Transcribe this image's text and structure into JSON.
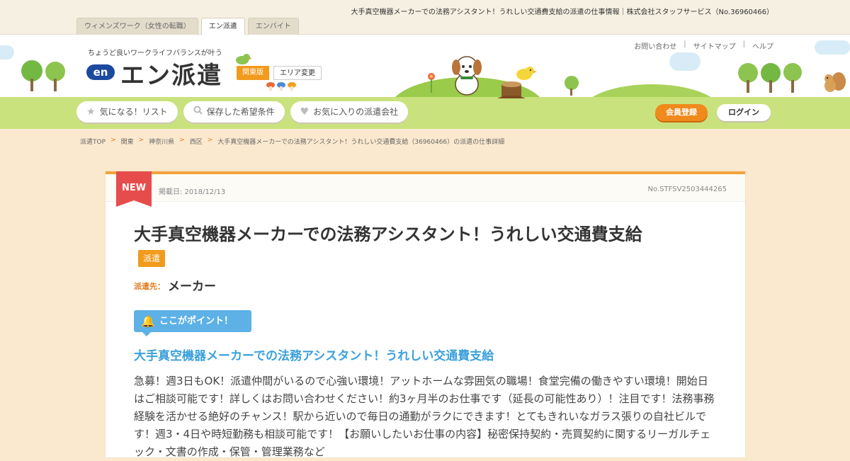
{
  "window": {
    "title": "大手真空機器メーカーでの法務アシスタント！うれしい交通費支給の派遣の仕事情報｜株式会社スタッフサービス（No.36960466）"
  },
  "site_tabs": [
    {
      "label": "ウィメンズワーク（女性の転職）",
      "active": false
    },
    {
      "label": "エン派遣",
      "active": true
    },
    {
      "label": "エンバイト",
      "active": false
    }
  ],
  "header": {
    "tagline": "ちょうど良いワークライフバランスが叶う",
    "logo_badge": "en",
    "logo_text": "エン派遣",
    "region": "関東版",
    "area_change": "エリア変更",
    "util_links": [
      "お問い合わせ",
      "サイトマップ",
      "ヘルプ"
    ],
    "util_sep": "|"
  },
  "nav": {
    "items": [
      {
        "icon": "star-icon",
        "label": "気になる！リスト"
      },
      {
        "icon": "search-icon",
        "label": "保存した希望条件"
      },
      {
        "icon": "heart-icon",
        "label": "お気に入りの派遣会社"
      }
    ],
    "register": "会員登録",
    "login": "ログイン"
  },
  "breadcrumb": {
    "items": [
      "派遣TOP",
      "関東",
      "神奈川県",
      "西区",
      "大手真空機器メーカーでの法務アシスタント！うれしい交通費支給（36960466）の派遣の仕事詳細"
    ],
    "sep": ">"
  },
  "job": {
    "new_label": "NEW",
    "post_date": "掲載日: 2018/12/13",
    "job_no": "No.STFSV2503444265",
    "title": "大手真空機器メーカーでの法務アシスタント！うれしい交通費支給",
    "type": "派遣",
    "dispatch_label": "派遣先：",
    "dispatch_value": "メーカー",
    "point_label": "ここがポイント！",
    "point_title": "大手真空機器メーカーでの法務アシスタント！うれしい交通費支給",
    "description": "急募！週3日もOK！派遣仲間がいるので心強い環境！アットホームな雰囲気の職場！食堂完備の働きやすい環境！開始日はご相談可能です！詳しくはお問い合わせください！約3ヶ月半のお仕事です（延長の可能性あり）！注目です！法務事務経験を活かせる絶好のチャンス！駅から近いので毎日の通勤がラクにできます！とてもきれいなガラス張りの自社ビルです！週3・4日や時短勤務も相談可能です！【お願いしたいお仕事の内容】秘密保持契約・売買契約に関するリーガルチェック・文書の作成・保管・管理業務など"
  },
  "colors": {
    "accent": "#f29a1c",
    "new_ribbon": "#e74c4c",
    "point_blue": "#5db1e6",
    "page_bg": "#fbe9cf"
  }
}
